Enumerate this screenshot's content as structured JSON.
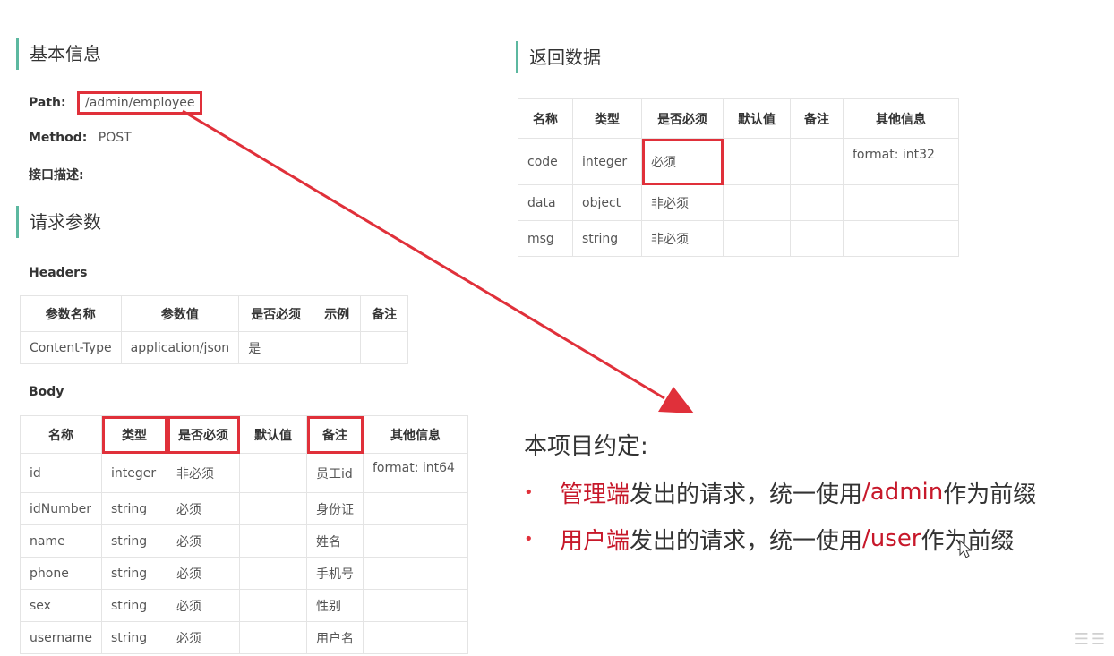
{
  "left": {
    "basic_title": "基本信息",
    "path_label": "Path:",
    "path_value": "/admin/employee",
    "method_label": "Method:",
    "method_value": "POST",
    "desc_label": "接口描述:",
    "req_title": "请求参数",
    "headers_label": "Headers",
    "headers_table": {
      "columns": [
        "参数名称",
        "参数值",
        "是否必须",
        "示例",
        "备注"
      ],
      "rows": [
        [
          "Content-Type",
          "application/json",
          "是",
          "",
          ""
        ]
      ]
    },
    "body_label": "Body",
    "body_table": {
      "columns": [
        "名称",
        "类型",
        "是否必须",
        "默认值",
        "备注",
        "其他信息"
      ],
      "rows": [
        [
          "id",
          "integer",
          "非必须",
          "",
          "员工id",
          "format: int64"
        ],
        [
          "idNumber",
          "string",
          "必须",
          "",
          "身份证",
          ""
        ],
        [
          "name",
          "string",
          "必须",
          "",
          "姓名",
          ""
        ],
        [
          "phone",
          "string",
          "必须",
          "",
          "手机号",
          ""
        ],
        [
          "sex",
          "string",
          "必须",
          "",
          "性别",
          ""
        ],
        [
          "username",
          "string",
          "必须",
          "",
          "用户名",
          ""
        ]
      ]
    }
  },
  "right": {
    "return_title": "返回数据",
    "return_table": {
      "columns": [
        "名称",
        "类型",
        "是否必须",
        "默认值",
        "备注",
        "其他信息"
      ],
      "rows": [
        [
          "code",
          "integer",
          "必须",
          "",
          "",
          "format: int32"
        ],
        [
          "data",
          "object",
          "非必须",
          "",
          "",
          ""
        ],
        [
          "msg",
          "string",
          "非必须",
          "",
          "",
          ""
        ]
      ]
    },
    "convention_title": "本项目约定:",
    "items": [
      {
        "highlight": "管理端",
        "text1": "发出的请求，统一使用 ",
        "path": "/admin",
        "text2": " 作为前缀"
      },
      {
        "highlight": "用户端",
        "text1": "发出的请求，统一使用 ",
        "path": "/user",
        "text2": " 作为前缀"
      }
    ]
  },
  "colors": {
    "accent_red": "#e0303a",
    "highlight_text": "#c7182a",
    "section_bar": "#5cb8a0"
  }
}
